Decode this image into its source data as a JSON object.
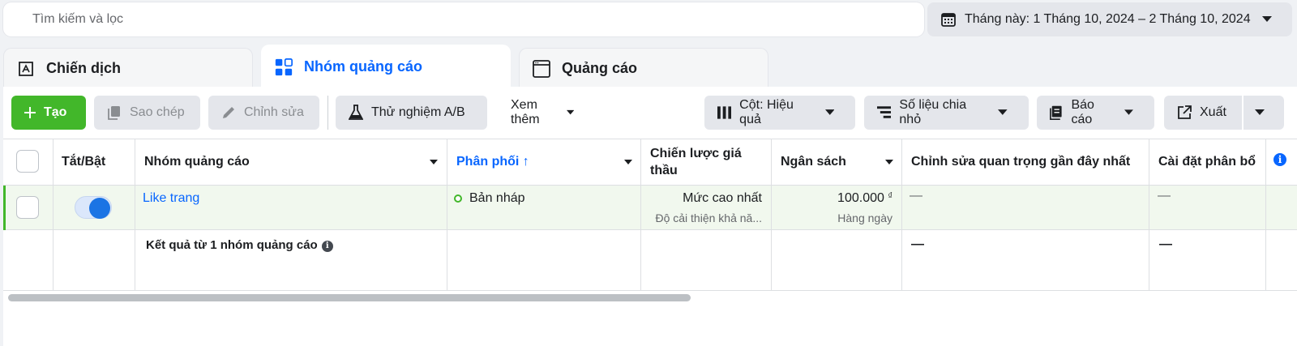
{
  "search": {
    "placeholder": "Tìm kiếm và lọc"
  },
  "date_range": {
    "label": "Tháng này: 1 Tháng 10, 2024 – 2 Tháng 10, 2024"
  },
  "tabs": [
    {
      "label": "Chiến dịch",
      "icon": "campaign-icon"
    },
    {
      "label": "Nhóm quảng cáo",
      "icon": "grid-icon"
    },
    {
      "label": "Quảng cáo",
      "icon": "ad-window-icon"
    }
  ],
  "toolbar": {
    "create": "Tạo",
    "duplicate": "Sao chép",
    "edit": "Chỉnh sửa",
    "ab_test": "Thử nghiệm A/B",
    "more": "Xem thêm",
    "columns": "Cột: Hiệu quả",
    "breakdown": "Số liệu chia nhỏ",
    "reports": "Báo cáo",
    "export": "Xuất"
  },
  "table": {
    "headers": {
      "toggle": "Tắt/Bật",
      "adset": "Nhóm quảng cáo",
      "delivery": "Phân phối ↑",
      "bid_strategy": "Chiến lược giá thầu",
      "budget": "Ngân sách",
      "last_edit": "Chỉnh sửa quan trọng gần đây nhất",
      "attribution": "Cài đặt phân bổ"
    },
    "row": {
      "name": "Like trang",
      "delivery": "Bản nháp",
      "bid": "Mức cao nhất",
      "bid_sub": "Độ cải thiện khả nă...",
      "budget": "100.000",
      "currency": "₫",
      "budget_sub": "Hàng ngày",
      "last_edit": "—",
      "attribution": "—"
    },
    "summary": {
      "label": "Kết quả từ 1 nhóm quảng cáo",
      "last_edit": "—",
      "attribution": "—"
    }
  },
  "colors": {
    "accent": "#0866ff",
    "create": "#42b72a",
    "row_bg": "#f1f8ee"
  }
}
